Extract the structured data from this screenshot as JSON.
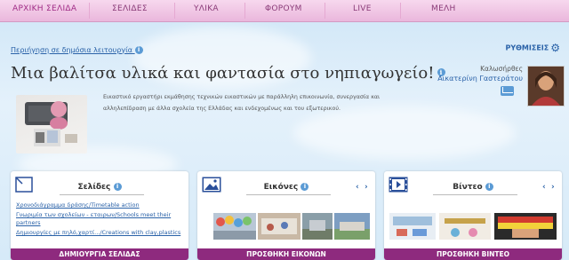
{
  "nav": [
    "ΑΡΧΙΚΗ ΣΕΛΙΔΑ",
    "ΣΕΛΙΔΕΣ",
    "ΥΛΙΚΑ",
    "ΦΟΡΟΥΜ",
    "LIVE",
    "ΜΕΛΗ"
  ],
  "public_link": "Περιήγηση σε δημόσια λειτουργία",
  "settings_label": "ΡΥΘΜΙΣΕΙΣ",
  "title": "Μια βαλίτσα υλικά και φαντασία στο νηπιαγωγείο!",
  "description": "Εικαστικό εργαστήρι εκμάθησης τεχνικών εικαστικών με παράλληλη επικοινωνία, συνεργασία και αλληλεπίδραση με άλλα σχολεία της Ελλάδας και ενδεχομένως και του εξωτερικού.",
  "greeting": "Καλωσήρθες",
  "user_name": "Αικατερίνη Γαστεράτου",
  "panels": {
    "pages": {
      "title": "Σελίδες",
      "items": [
        "Χρονοδιάγραμμα δράσης/Timetable action",
        "Γνωριμία των σχολείων - εταιρων/Schools meet their partners",
        "Δημιουργίες με πηλό,χαρτί.../Creations with clay,plastics"
      ],
      "button": "ΔΗΜΙΟΥΡΓΙΑ ΣΕΛΙΔΑΣ"
    },
    "images": {
      "title": "Εικόνες",
      "button": "ΠΡΟΣΘΗΚΗ ΕΙΚΟΝΩΝ"
    },
    "videos": {
      "title": "Βίντεο",
      "button": "ΠΡΟΣΘΗΚΗ ΒΙΝΤΕΟ"
    }
  },
  "colors": {
    "accent": "#8e2a7e",
    "link": "#2a62a8",
    "nav_bg": "#eab7dc"
  }
}
